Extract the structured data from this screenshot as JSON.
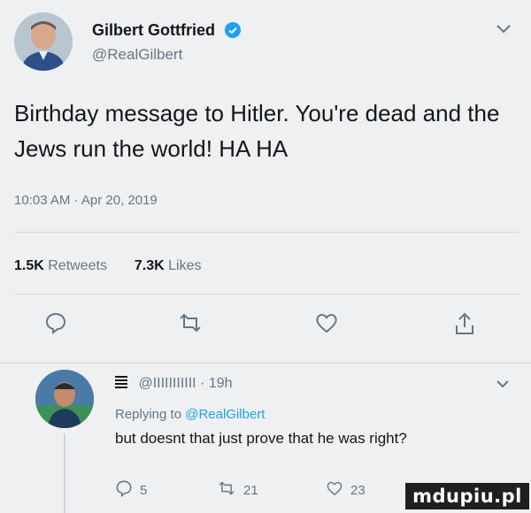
{
  "tweet": {
    "author_name": "Gilbert Gottfried",
    "author_handle": "@RealGilbert",
    "text": "Birthday message to Hitler. You're dead and the Jews run the world! HA HA",
    "timestamp": "10:03 AM · Apr 20, 2019",
    "stats": {
      "retweets_count": "1.5K",
      "retweets_label": "Retweets",
      "likes_count": "7.3K",
      "likes_label": "Likes"
    },
    "icons": [
      "reply-icon",
      "retweet-icon",
      "like-icon",
      "share-icon",
      "verified-icon",
      "chevron-down-icon"
    ]
  },
  "reply": {
    "handle": "@IIIIIIIIIII",
    "time": "19h",
    "replying_prefix": "Replying to",
    "replying_mention": "@RealGilbert",
    "text": "but doesnt that just prove that he was right?",
    "reply_count": "5",
    "retweet_count": "21",
    "like_count": "23"
  },
  "watermark": {
    "text": "mdupiu.pl"
  },
  "colors": {
    "accent": "#1da1f2",
    "secondary_text": "#657786",
    "background": "#eef0f2"
  }
}
